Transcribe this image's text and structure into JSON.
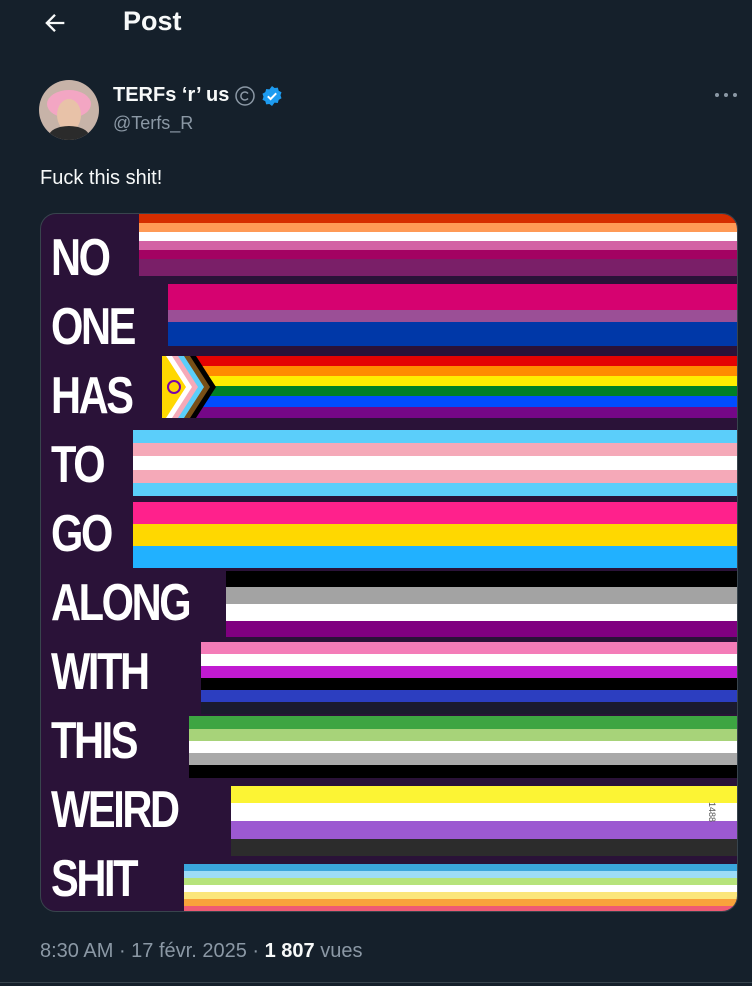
{
  "header": {
    "title": "Post"
  },
  "author": {
    "name": "TERFs ‘r’ us",
    "handle": "@Terfs_R"
  },
  "post": {
    "text": "Fuck this shit!",
    "image_words": [
      "NO",
      "ONE",
      "HAS",
      "TO",
      "GO",
      "ALONG",
      "WITH",
      "THIS",
      "WEIRD",
      "SHIT"
    ],
    "watermark": "1488"
  },
  "meta": {
    "time": "8:30 AM",
    "date": "17 févr. 2025",
    "views_count": "1 807",
    "views_label": "vues"
  },
  "colors": {
    "background": "#15202b",
    "muted": "#8b98a5",
    "verified": "#1d9bf0"
  }
}
